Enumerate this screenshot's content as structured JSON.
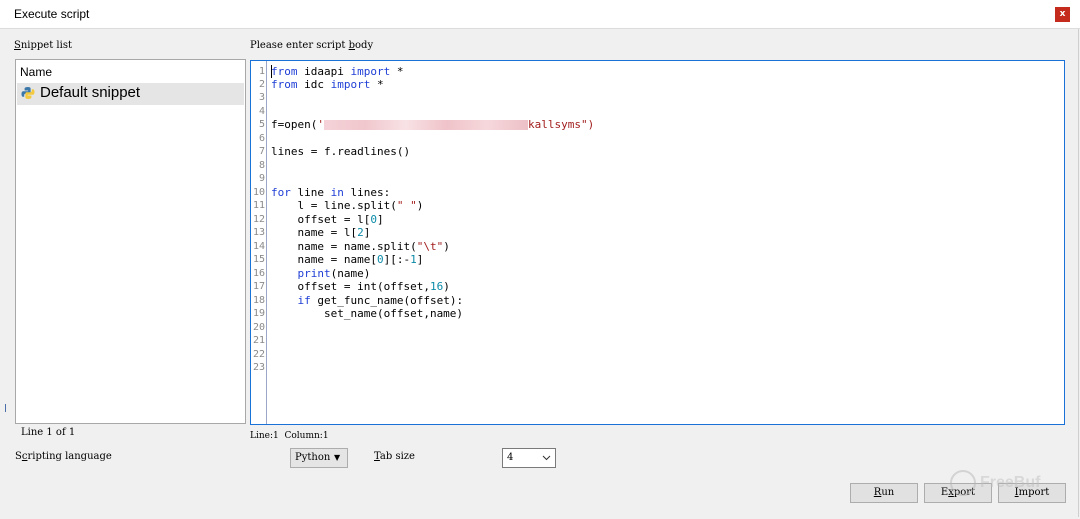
{
  "window": {
    "title": "Execute script",
    "close_glyph": "x"
  },
  "snippet_list": {
    "label_pre": "",
    "label_u": "S",
    "label_post": "nippet list",
    "header": "Name",
    "items": [
      {
        "label": "Default snippet",
        "icon": "python-icon"
      }
    ],
    "status": "Line 1 of 1"
  },
  "editor": {
    "label_pre": "Please enter script ",
    "label_u": "b",
    "label_post": "ody",
    "status_line": "Line:1",
    "status_column": "Column:1",
    "line_numbers": [
      "1",
      "2",
      "3",
      "4",
      "5",
      "6",
      "7",
      "8",
      "9",
      "10",
      "11",
      "12",
      "13",
      "14",
      "15",
      "16",
      "17",
      "18",
      "19",
      "20",
      "21",
      "22",
      "23"
    ],
    "code": {
      "l1_kw1": "from",
      "l1_mod": " idaapi ",
      "l1_kw2": "import",
      "l1_rest": " *",
      "l2_kw1": "from",
      "l2_mod": " idc ",
      "l2_kw2": "import",
      "l2_rest": " *",
      "l5_a": "f=open(",
      "l5_q": "'",
      "l5_tail": "kallsyms\")",
      "l7": "lines = f.readlines()",
      "l10_kw1": "for",
      "l10_a": " line ",
      "l10_kw2": "in",
      "l10_b": " lines:",
      "l11_a": "    l = line.split(",
      "l11_s": "\" \"",
      "l11_b": ")",
      "l12_a": "    offset = l[",
      "l12_n": "0",
      "l12_b": "]",
      "l13_a": "    name = l[",
      "l13_n": "2",
      "l13_b": "]",
      "l14_a": "    name = name.split(",
      "l14_s": "\"\\t\"",
      "l14_b": ")",
      "l15_a": "    name = name[",
      "l15_n1": "0",
      "l15_b": "][:-",
      "l15_n2": "1",
      "l15_c": "]",
      "l16_a": "    ",
      "l16_kw": "print",
      "l16_b": "(name)",
      "l17_a": "    offset = int(offset,",
      "l17_n": "16",
      "l17_b": ")",
      "l18_a": "    ",
      "l18_kw": "if",
      "l18_b": " get_func_name(offset):",
      "l19": "        set_name(offset,name)"
    }
  },
  "scripting": {
    "label_pre": "S",
    "label_u": "c",
    "label_post": "ripting language",
    "language_value": "Python",
    "tab_label_u": "T",
    "tab_label_post": "ab size",
    "tab_value": "4"
  },
  "buttons": {
    "run_u": "R",
    "run_post": "un",
    "export_pre": "E",
    "export_u": "x",
    "export_post": "port",
    "import_u": "I",
    "import_post": "mport"
  },
  "watermark": "FreeBuf",
  "colors": {
    "editor_border": "#1a72d9",
    "keyword": "#1f3fd6",
    "string": "#a21d1d",
    "number": "#0a8aa8",
    "close": "#c42b1c"
  }
}
